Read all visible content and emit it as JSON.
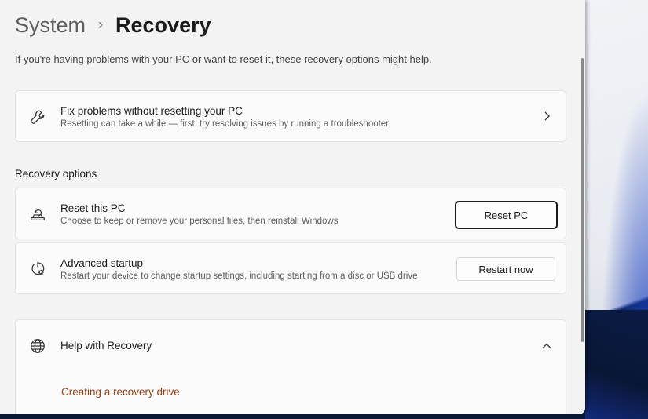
{
  "breadcrumb": {
    "parent": "System",
    "separator": "›",
    "current": "Recovery"
  },
  "intro": "If you're having problems with your PC or want to reset it, these recovery options might help.",
  "fix_card": {
    "title": "Fix problems without resetting your PC",
    "description": "Resetting can take a while — first, try resolving issues by running a troubleshooter",
    "icon": "wrench-icon"
  },
  "recovery_section": {
    "title": "Recovery options",
    "items": [
      {
        "title": "Reset this PC",
        "description": "Choose to keep or remove your personal files, then reinstall Windows",
        "button": "Reset PC",
        "icon": "reset-pc-icon"
      },
      {
        "title": "Advanced startup",
        "description": "Restart your device to change startup settings, including starting from a disc or USB drive",
        "button": "Restart now",
        "icon": "advanced-startup-icon"
      }
    ]
  },
  "help": {
    "title": "Help with Recovery",
    "icon": "globe-icon",
    "expanded": true,
    "links": [
      "Creating a recovery drive"
    ]
  },
  "colors": {
    "link": "#9a3b0e",
    "background": "#f3f3f3",
    "card": "#fbfbfb"
  }
}
